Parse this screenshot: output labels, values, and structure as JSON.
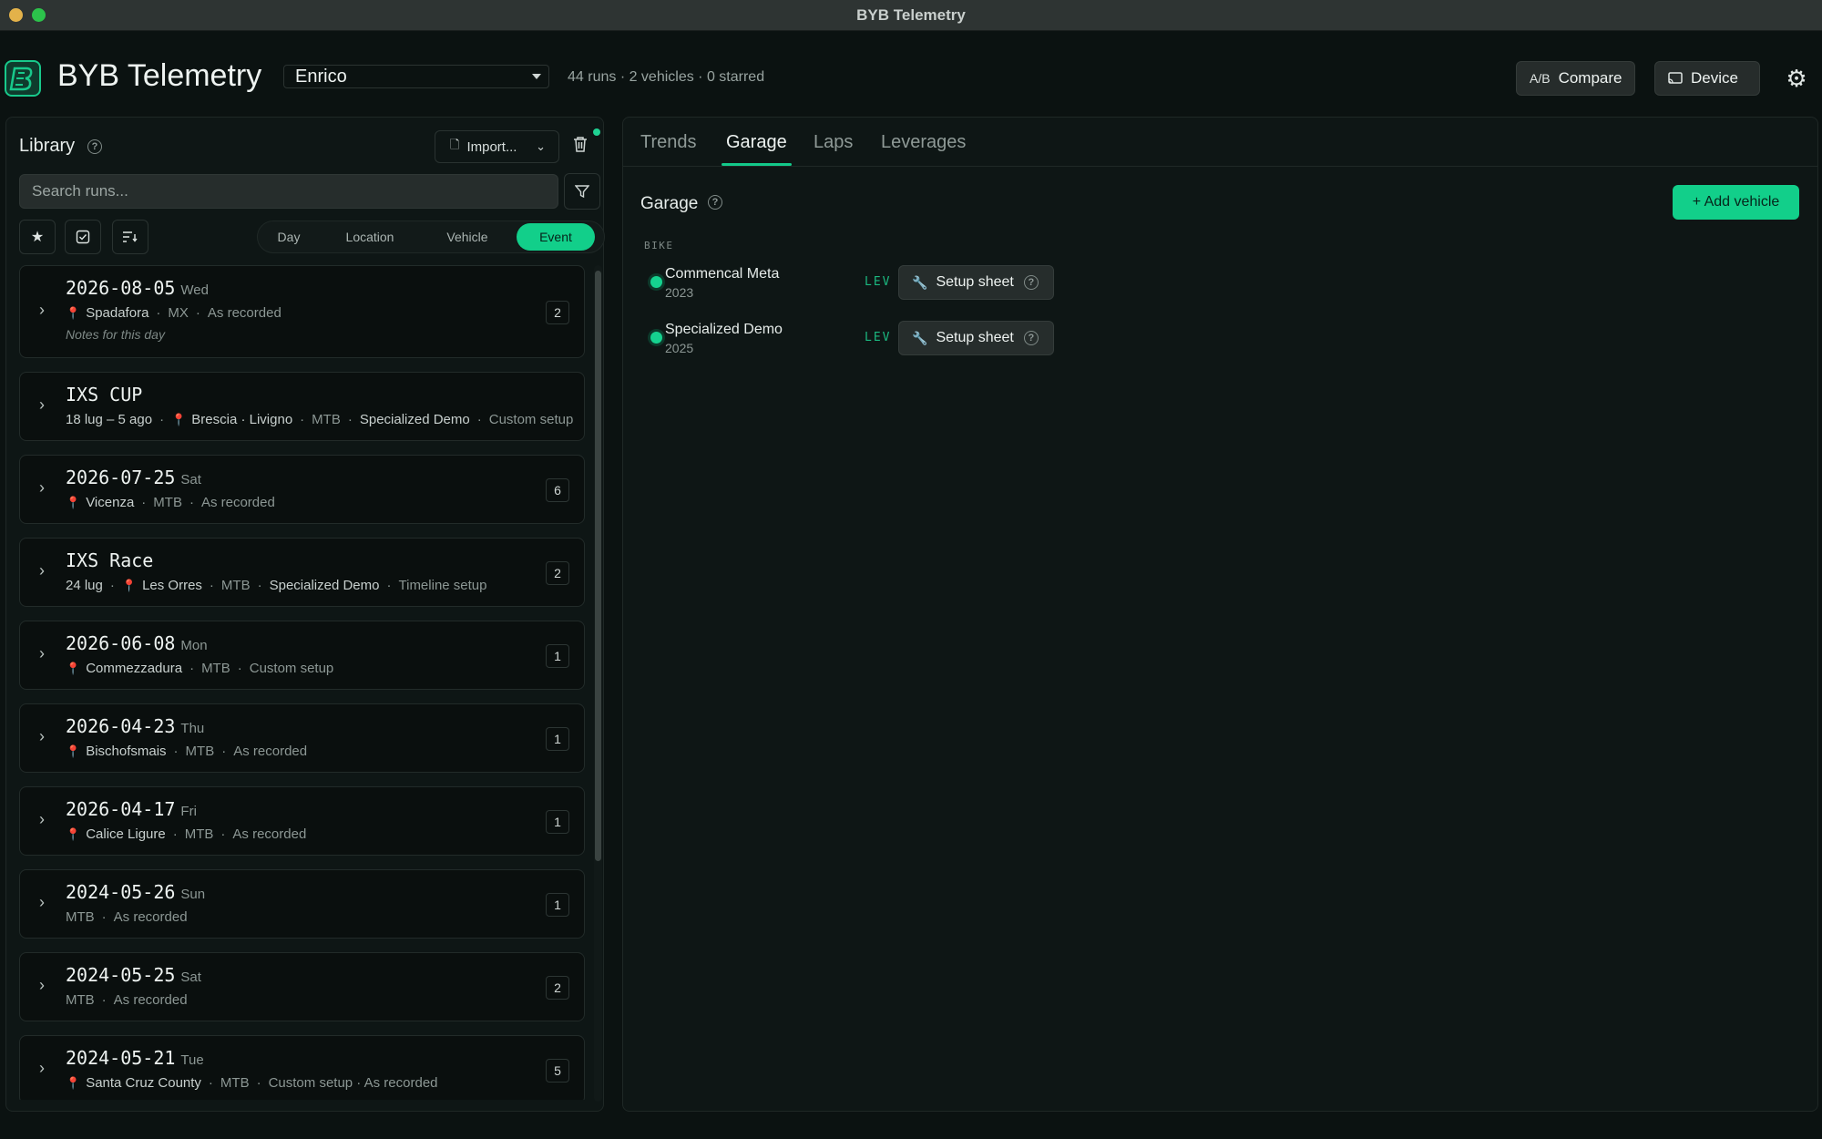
{
  "window": {
    "title": "BYB Telemetry"
  },
  "header": {
    "app_title": "BYB Telemetry",
    "user": "Enrico",
    "stats": "44 runs · 2 vehicles · 0 starred",
    "compare_label": "Compare",
    "device_label": "Device"
  },
  "library": {
    "title": "Library",
    "import_label": "Import...",
    "search_placeholder": "Search runs...",
    "group_options": [
      "Day",
      "Location",
      "Vehicle",
      "Event"
    ],
    "group_selected": "Event",
    "items": [
      {
        "title": "2026-08-05",
        "dow": "Wed",
        "meta": [
          {
            "pin": true,
            "t": "Spadafora",
            "hi": true
          },
          {
            "t": "MX"
          },
          {
            "t": "As recorded"
          }
        ],
        "note": "Notes for this day",
        "count": "2"
      },
      {
        "title": "IXS CUP",
        "dow": "",
        "meta": [
          {
            "t": "18 lug – 5 ago",
            "hi": true
          },
          {
            "pin": true,
            "t": "Brescia · Livigno",
            "hi": true
          },
          {
            "t": "MTB"
          },
          {
            "t": "Specialized Demo",
            "hi": true
          },
          {
            "t": "Custom setup"
          }
        ],
        "note": "",
        "count": ""
      },
      {
        "title": "2026-07-25",
        "dow": "Sat",
        "meta": [
          {
            "pin": true,
            "t": "Vicenza",
            "hi": true
          },
          {
            "t": "MTB"
          },
          {
            "t": "As recorded"
          }
        ],
        "note": "",
        "count": "6"
      },
      {
        "title": "IXS Race",
        "dow": "",
        "meta": [
          {
            "t": "24 lug",
            "hi": true
          },
          {
            "pin": true,
            "t": "Les Orres",
            "hi": true
          },
          {
            "t": "MTB"
          },
          {
            "t": "Specialized Demo",
            "hi": true
          },
          {
            "t": "Timeline setup"
          }
        ],
        "note": "",
        "count": "2"
      },
      {
        "title": "2026-06-08",
        "dow": "Mon",
        "meta": [
          {
            "pin": true,
            "t": "Commezzadura",
            "hi": true
          },
          {
            "t": "MTB"
          },
          {
            "t": "Custom setup"
          }
        ],
        "note": "",
        "count": "1"
      },
      {
        "title": "2026-04-23",
        "dow": "Thu",
        "meta": [
          {
            "pin": true,
            "t": "Bischofsmais",
            "hi": true
          },
          {
            "t": "MTB"
          },
          {
            "t": "As recorded"
          }
        ],
        "note": "",
        "count": "1"
      },
      {
        "title": "2026-04-17",
        "dow": "Fri",
        "meta": [
          {
            "pin": true,
            "t": "Calice Ligure",
            "hi": true
          },
          {
            "t": "MTB"
          },
          {
            "t": "As recorded"
          }
        ],
        "note": "",
        "count": "1"
      },
      {
        "title": "2024-05-26",
        "dow": "Sun",
        "meta": [
          {
            "t": "MTB"
          },
          {
            "t": "As recorded"
          }
        ],
        "note": "",
        "count": "1"
      },
      {
        "title": "2024-05-25",
        "dow": "Sat",
        "meta": [
          {
            "t": "MTB"
          },
          {
            "t": "As recorded"
          }
        ],
        "note": "",
        "count": "2"
      },
      {
        "title": "2024-05-21",
        "dow": "Tue",
        "meta": [
          {
            "pin": true,
            "t": "Santa Cruz County",
            "hi": true
          },
          {
            "t": "MTB"
          },
          {
            "t": "Custom setup · As recorded"
          }
        ],
        "note": "",
        "count": "5"
      }
    ]
  },
  "tabs": [
    "Trends",
    "Garage",
    "Laps",
    "Leverages"
  ],
  "active_tab": "Garage",
  "garage": {
    "title": "Garage",
    "add_label": "+ Add vehicle",
    "section": "BIKE",
    "vehicles": [
      {
        "name": "Commencal Meta",
        "year": "2023",
        "tag": "LEV",
        "setup_label": "Setup sheet"
      },
      {
        "name": "Specialized Demo",
        "year": "2025",
        "tag": "LEV",
        "setup_label": "Setup sheet"
      }
    ]
  },
  "colors": {
    "accent": "#12cf8a",
    "background": "#0b1211",
    "panel": "#0e1615"
  }
}
